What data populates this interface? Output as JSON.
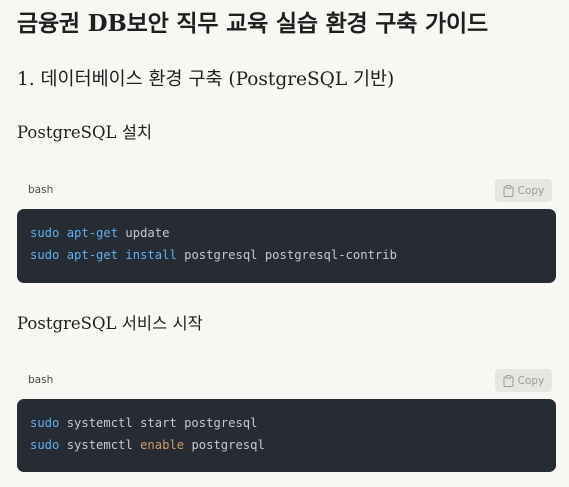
{
  "document": {
    "title": "금융권 DB보안 직무 교육 실습 환경 구축 가이드",
    "section_heading": "1. 데이터베이스 환경 구축 (PostgreSQL 기반)",
    "subsections": [
      {
        "heading": "PostgreSQL 설치",
        "code": {
          "language": "bash",
          "copy_label": "Copy",
          "copy_icon": "clipboard-icon",
          "lines": [
            [
              {
                "text": "sudo",
                "kind": "cmd"
              },
              {
                "text": " ",
                "kind": "plain"
              },
              {
                "text": "apt-get",
                "kind": "cmd"
              },
              {
                "text": " update",
                "kind": "plain"
              }
            ],
            [
              {
                "text": "sudo",
                "kind": "cmd"
              },
              {
                "text": " ",
                "kind": "plain"
              },
              {
                "text": "apt-get",
                "kind": "cmd"
              },
              {
                "text": " ",
                "kind": "plain"
              },
              {
                "text": "install",
                "kind": "cmd"
              },
              {
                "text": " postgresql postgresql-contrib",
                "kind": "plain"
              }
            ]
          ]
        }
      },
      {
        "heading": "PostgreSQL 서비스 시작",
        "code": {
          "language": "bash",
          "copy_label": "Copy",
          "copy_icon": "clipboard-icon",
          "lines": [
            [
              {
                "text": "sudo",
                "kind": "cmd"
              },
              {
                "text": " systemctl start postgresql",
                "kind": "plain"
              }
            ],
            [
              {
                "text": "sudo",
                "kind": "cmd"
              },
              {
                "text": " systemctl ",
                "kind": "plain"
              },
              {
                "text": "enable",
                "kind": "kw"
              },
              {
                "text": " postgresql",
                "kind": "plain"
              }
            ]
          ]
        }
      }
    ]
  },
  "colors": {
    "page_background": "#f8f7f3",
    "code_background": "#262b34",
    "command_token": "#61afef",
    "keyword_token": "#d19a66",
    "plain_token": "#c5c9d0",
    "copy_button_background": "#e7e6e2"
  }
}
